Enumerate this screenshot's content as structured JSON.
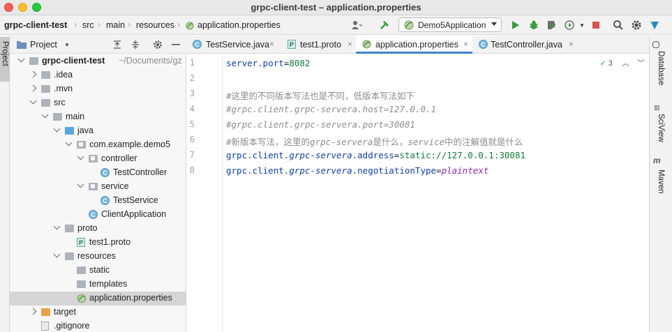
{
  "window": {
    "title": "grpc-client-test – application.properties"
  },
  "breadcrumbs": [
    "grpc-client-test",
    "src",
    "main",
    "resources",
    "application.properties"
  ],
  "toolbar": {
    "run_config": "Demo5Application",
    "icons": [
      "user-icon",
      "hammer-icon",
      "run-icon",
      "debug-icon",
      "coverage-icon",
      "profile-icon",
      "stop-icon",
      "search-icon",
      "settings-icon",
      "plugin-icon"
    ]
  },
  "left_stripe": {
    "project_label": "Project"
  },
  "project_panel": {
    "title": "Project",
    "tree": [
      {
        "label": "grpc-client-test",
        "suffix": "~/Documents/gz",
        "indent": 0,
        "expanded": true,
        "icon": "folder-gray",
        "bold": true
      },
      {
        "label": ".idea",
        "indent": 1,
        "expanded": false,
        "icon": "folder-gray"
      },
      {
        "label": ".mvn",
        "indent": 1,
        "expanded": false,
        "icon": "folder-gray"
      },
      {
        "label": "src",
        "indent": 1,
        "expanded": true,
        "icon": "folder-gray"
      },
      {
        "label": "main",
        "indent": 2,
        "expanded": true,
        "icon": "folder-gray"
      },
      {
        "label": "java",
        "indent": 3,
        "expanded": true,
        "icon": "folder-blue"
      },
      {
        "label": "com.example.demo5",
        "indent": 4,
        "expanded": true,
        "icon": "package"
      },
      {
        "label": "controller",
        "indent": 5,
        "expanded": true,
        "icon": "package"
      },
      {
        "label": "TestController",
        "indent": 6,
        "icon": "class"
      },
      {
        "label": "service",
        "indent": 5,
        "expanded": true,
        "icon": "package"
      },
      {
        "label": "TestService",
        "indent": 6,
        "icon": "class"
      },
      {
        "label": "ClientApplication",
        "indent": 5,
        "icon": "class-app"
      },
      {
        "label": "proto",
        "indent": 3,
        "expanded": true,
        "icon": "folder-mixed"
      },
      {
        "label": "test1.proto",
        "indent": 4,
        "icon": "proto"
      },
      {
        "label": "resources",
        "indent": 3,
        "expanded": true,
        "icon": "folder-mixed"
      },
      {
        "label": "static",
        "indent": 4,
        "icon": "folder-gray"
      },
      {
        "label": "templates",
        "indent": 4,
        "icon": "folder-gray"
      },
      {
        "label": "application.properties",
        "indent": 4,
        "icon": "properties",
        "selected": true
      },
      {
        "label": "target",
        "indent": 1,
        "expanded": false,
        "icon": "folder-orange"
      },
      {
        "label": ".gitignore",
        "indent": 1,
        "icon": "file"
      }
    ]
  },
  "editor": {
    "tabs": [
      {
        "label": "TestService.java",
        "icon": "class",
        "active": false
      },
      {
        "label": "test1.proto",
        "icon": "proto",
        "active": false
      },
      {
        "label": "application.properties",
        "icon": "properties",
        "active": true
      },
      {
        "label": "TestController.java",
        "icon": "class",
        "active": false
      }
    ],
    "inspection_count": "3",
    "line_numbers": [
      "1",
      "2",
      "3",
      "4",
      "5",
      "6",
      "7",
      "8"
    ],
    "lines": [
      [
        {
          "t": "server.port",
          "c": "k-key"
        },
        {
          "t": "=",
          "c": "k-eq"
        },
        {
          "t": "8082",
          "c": "k-val"
        }
      ],
      [],
      [
        {
          "t": "#这里的不同版本写法也是不同，低版本写法如下",
          "c": "k-comment-cn"
        }
      ],
      [
        {
          "t": "#grpc.client.grpc-servera.host=127.0.0.1",
          "c": "k-comment"
        }
      ],
      [
        {
          "t": "#grpc.client.grpc-servera.port=30081",
          "c": "k-comment"
        }
      ],
      [
        {
          "t": "#新版本写法，这里的",
          "c": "k-comment-cn"
        },
        {
          "t": "grpc-servera",
          "c": "k-comment"
        },
        {
          "t": "是什么，",
          "c": "k-comment-cn"
        },
        {
          "t": "service",
          "c": "k-comment"
        },
        {
          "t": "中的注解值就是什么",
          "c": "k-comment-cn"
        }
      ],
      [
        {
          "t": "grpc.client.",
          "c": "k-key"
        },
        {
          "t": "grpc-servera",
          "c": "k-italic"
        },
        {
          "t": ".address",
          "c": "k-key"
        },
        {
          "t": "=",
          "c": "k-eq"
        },
        {
          "t": "static://127.0.0.1:30081",
          "c": "k-val"
        }
      ],
      [
        {
          "t": "grpc.client.",
          "c": "k-key"
        },
        {
          "t": "grpc-servera",
          "c": "k-italic"
        },
        {
          "t": ".negotiationType",
          "c": "k-key"
        },
        {
          "t": "=",
          "c": "k-eq"
        },
        {
          "t": "plaintext",
          "c": "k-val-italic"
        }
      ]
    ]
  },
  "right_stripe": {
    "items": [
      "Database",
      "SciView",
      "Maven"
    ]
  }
}
